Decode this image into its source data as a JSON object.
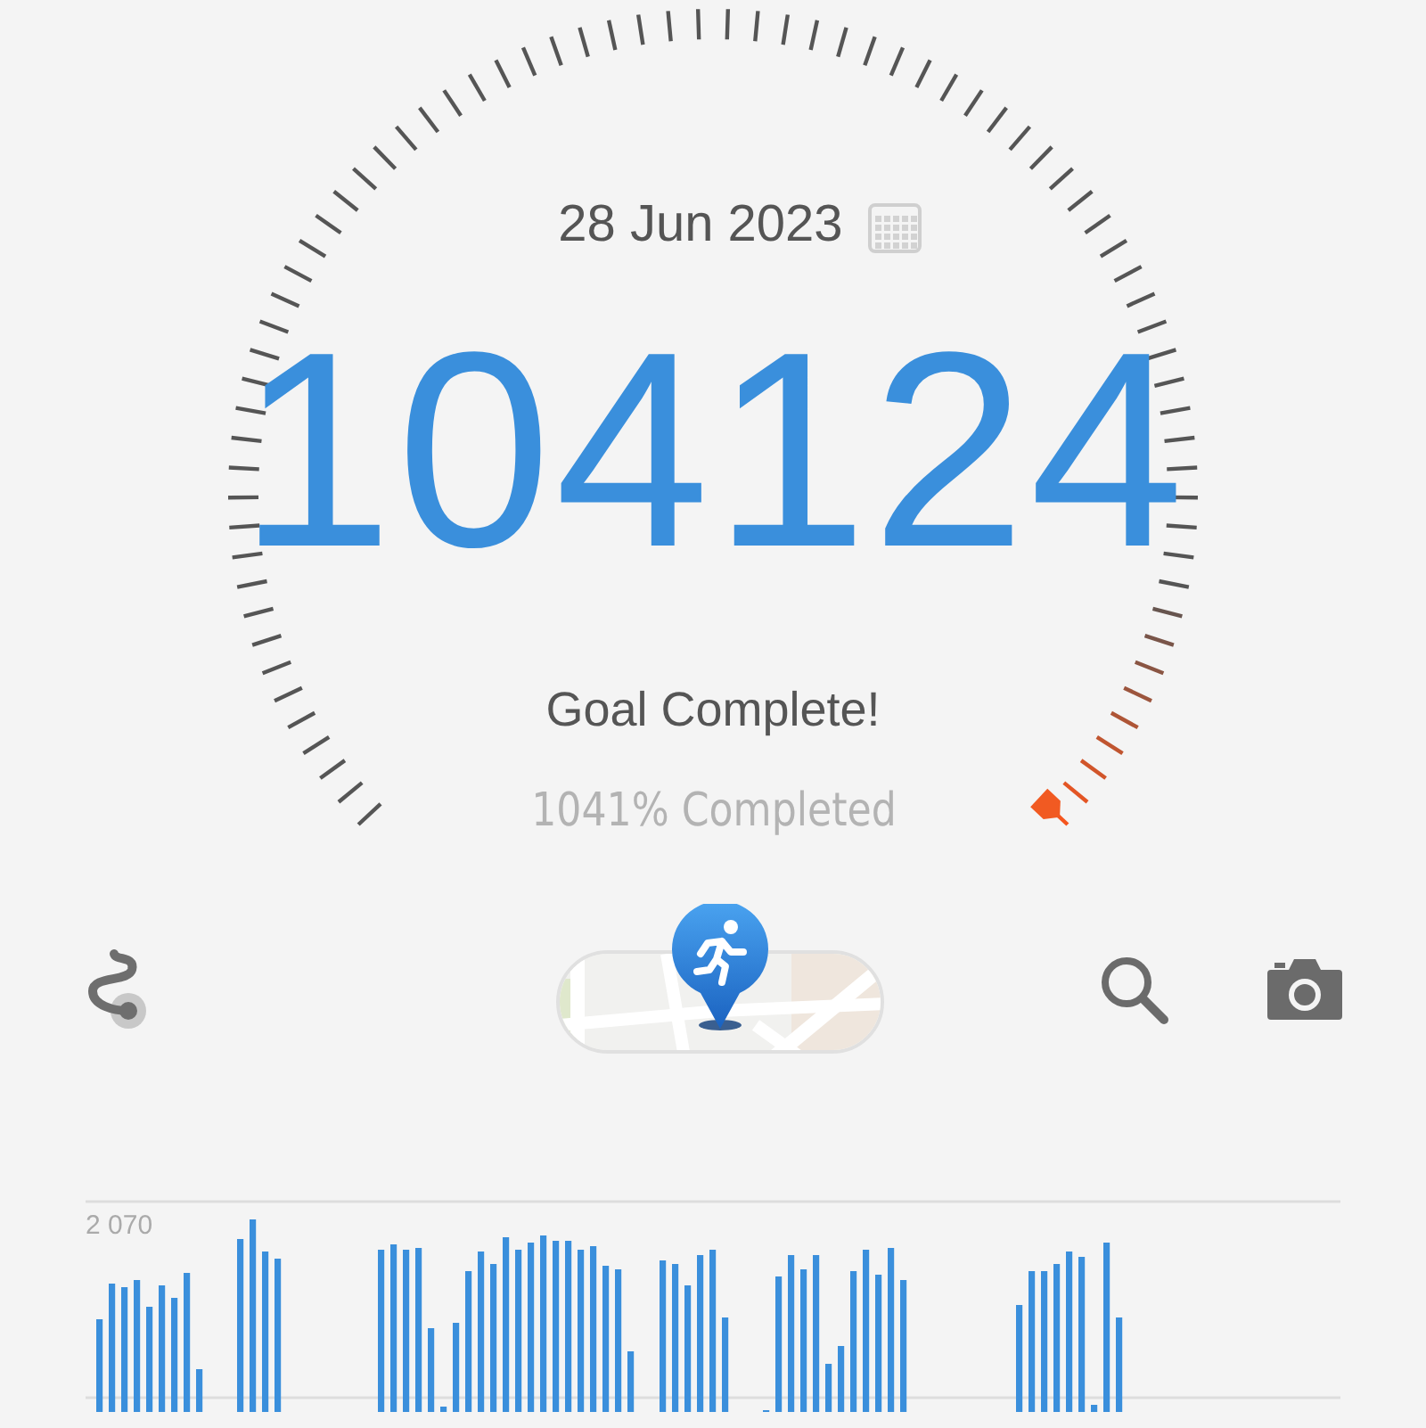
{
  "date": "28 Jun 2023",
  "steps": "104124",
  "goal_message": "Goal Complete!",
  "progress": {
    "text": "1041% Completed"
  },
  "chart": {
    "top_label": "2 070"
  }
}
